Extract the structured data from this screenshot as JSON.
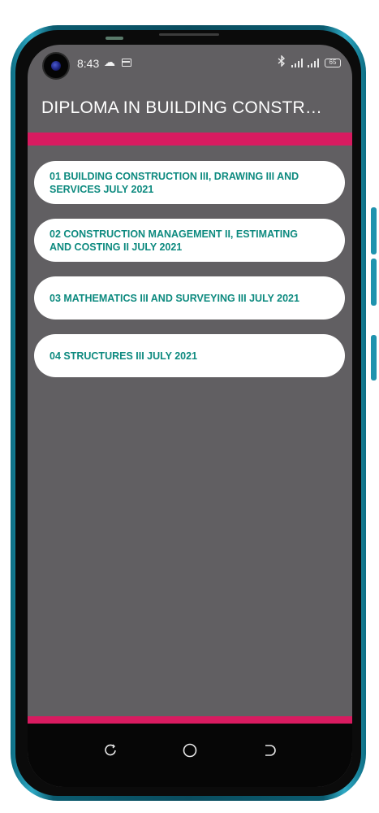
{
  "status_bar": {
    "time": "8:43",
    "icons": [
      "cloud-icon",
      "calendar-icon",
      "bluetooth-icon",
      "signal-icon",
      "signal-icon",
      "battery-icon"
    ],
    "battery_level": "65"
  },
  "app_bar": {
    "title": "DIPLOMA IN BUILDING CONSTRUCTION"
  },
  "list": {
    "items": [
      {
        "label": "01 BUILDING CONSTRUCTION III, DRAWING III AND SERVICES JULY 2021"
      },
      {
        "label": "02 CONSTRUCTION MANAGEMENT II, ESTIMATING AND COSTING II JULY 2021"
      },
      {
        "label": "03 MATHEMATICS III AND SURVEYING III JULY 2021"
      },
      {
        "label": "04 STRUCTURES III JULY 2021"
      }
    ]
  },
  "nav_bar": {
    "icons": [
      "recent-apps-icon",
      "home-icon",
      "back-icon"
    ]
  },
  "colors": {
    "accent": "#d81b60",
    "background": "#615f62",
    "item_text": "#0d8a7f",
    "item_bg": "#ffffff"
  }
}
